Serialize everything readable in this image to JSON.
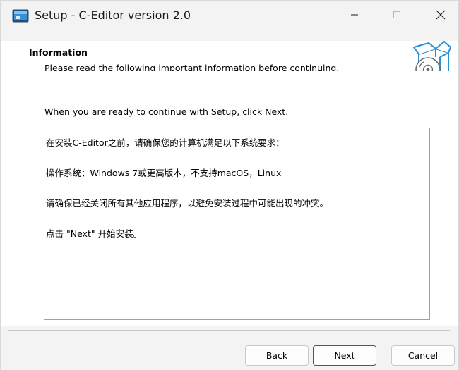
{
  "window": {
    "title": "Setup - C-Editor version 2.0",
    "controls": {
      "minimize": "minimize",
      "maximize": "maximize",
      "close": "close"
    }
  },
  "header": {
    "title": "Information",
    "subtitle": "Please read the following important information before continuing.",
    "graphic_icon": "box-with-disc-icon"
  },
  "body": {
    "prompt": "When you are ready to continue with Setup, click Next.",
    "info_lines": [
      "在安装C-Editor之前，请确保您的计算机满足以下系统要求：",
      "操作系统：Windows 7或更高版本，不支持macOS，Linux",
      "请确保已经关闭所有其他应用程序，以避免安装过程中可能出现的冲突。",
      "点击 \"Next\" 开始安装。"
    ]
  },
  "footer": {
    "back_label": "Back",
    "next_label": "Next",
    "cancel_label": "Cancel"
  },
  "colors": {
    "accent": "#0a64d6",
    "window_bg": "#f3f3f3",
    "content_bg": "#ffffff"
  }
}
